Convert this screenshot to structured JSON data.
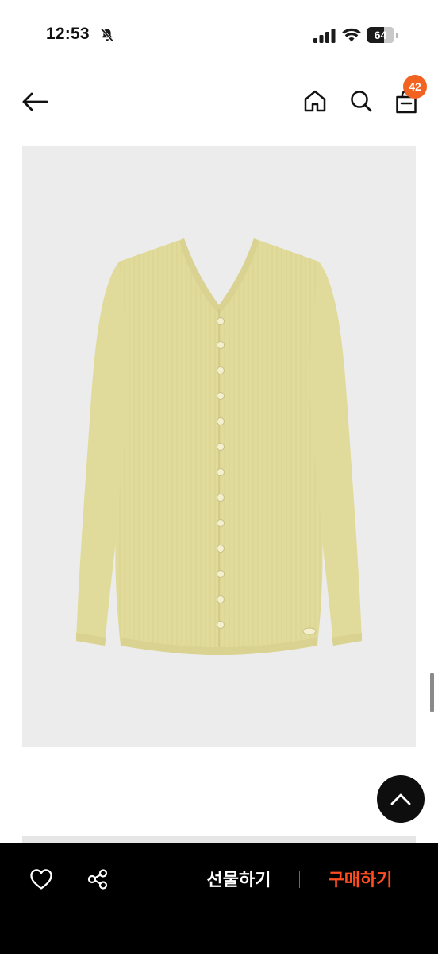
{
  "status_bar": {
    "time": "12:53",
    "battery_level": "64",
    "icons": [
      "bell-slash-icon",
      "signal-icon",
      "wifi-icon",
      "battery-icon"
    ]
  },
  "nav": {
    "icons": [
      "back-arrow-icon",
      "home-icon",
      "search-icon",
      "shopping-bag-icon"
    ],
    "cart_count": "42"
  },
  "product": {
    "image": "cardigan-image",
    "colors": {
      "garment": "#e1db9b",
      "background": "#ececec"
    }
  },
  "actions": {
    "icons": [
      "heart-icon",
      "share-icon",
      "chevron-up-icon"
    ],
    "gift_label": "선물하기",
    "buy_label": "구매하기"
  },
  "colors": {
    "accent": "#f26322",
    "buy_text": "#ff4d1f",
    "bottom_bar": "#000000"
  }
}
